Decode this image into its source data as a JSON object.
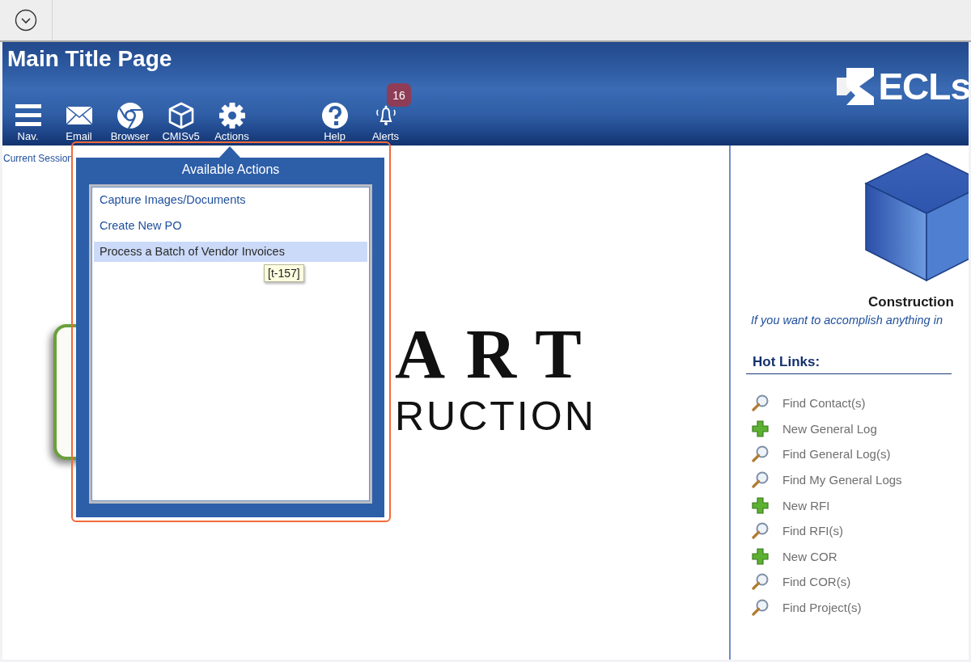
{
  "window": {
    "title": "Main Title Page"
  },
  "logo": {
    "text": "ECLs"
  },
  "toolbar": {
    "main": [
      {
        "label": "Nav.",
        "kind": "menu"
      },
      {
        "label": "Email",
        "kind": "mail"
      },
      {
        "label": "Browser",
        "kind": "browser"
      },
      {
        "label": "CMISv5",
        "kind": "cube"
      },
      {
        "label": "Actions",
        "kind": "gear"
      }
    ],
    "extra": [
      {
        "label": "Help",
        "kind": "help"
      },
      {
        "label": "Alerts",
        "kind": "bell",
        "badge": "16"
      }
    ]
  },
  "session": {
    "line_1": "Current Session"
  },
  "brand": {
    "line_1": "ART",
    "line_2": "RUCTION"
  },
  "actions_popup": {
    "title": "Available Actions",
    "items": [
      {
        "label": "Capture Images/Documents",
        "selected": false
      },
      {
        "label": "Create New PO",
        "selected": false
      },
      {
        "label": "Process a Batch of Vendor Invoices",
        "selected": true
      }
    ],
    "tooltip": "[t-157]"
  },
  "side": {
    "caption": "Construction",
    "tagline": "If you want to accomplish anything in",
    "hot_links_title": "Hot Links:",
    "hot_links": [
      {
        "label": "Find Contact(s)",
        "kind": "find"
      },
      {
        "label": "New General Log",
        "kind": "new"
      },
      {
        "label": "Find General Log(s)",
        "kind": "find"
      },
      {
        "label": "Find My General Logs",
        "kind": "find"
      },
      {
        "label": "New RFI",
        "kind": "new"
      },
      {
        "label": "Find RFI(s)",
        "kind": "find"
      },
      {
        "label": "New COR",
        "kind": "new"
      },
      {
        "label": "Find COR(s)",
        "kind": "find"
      },
      {
        "label": "Find Project(s)",
        "kind": "find"
      }
    ]
  }
}
